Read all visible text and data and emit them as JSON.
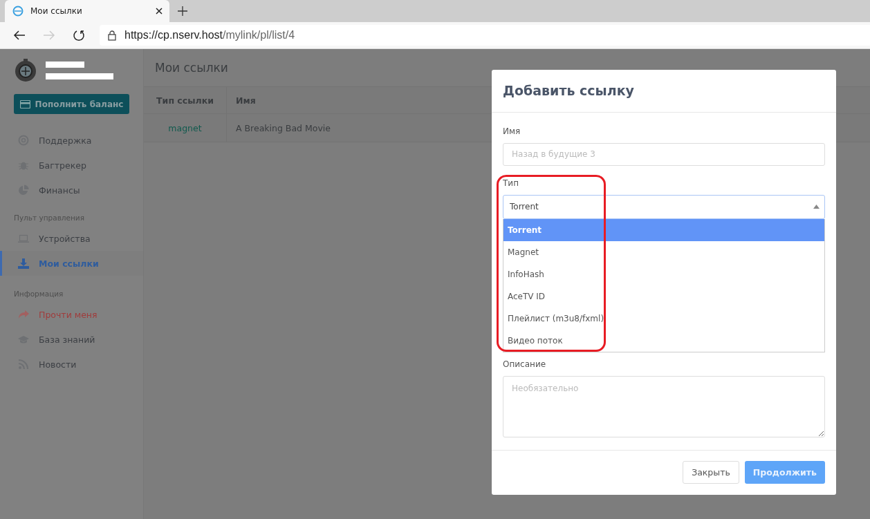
{
  "browser": {
    "tab_title": "Мои ссылки",
    "url_host": "https://cp.nserv.host",
    "url_path": "/mylink/pl/list/4"
  },
  "sidebar": {
    "balance_button": "Пополнить баланс",
    "groups": [
      {
        "items": [
          {
            "label": "Поддержка",
            "selected": false,
            "kind": "normal"
          },
          {
            "label": "Багтрекер",
            "selected": false,
            "kind": "normal"
          },
          {
            "label": "Финансы",
            "selected": false,
            "kind": "normal"
          }
        ]
      },
      {
        "heading": "Пульт управления",
        "items": [
          {
            "label": "Устройства",
            "selected": false,
            "kind": "normal"
          },
          {
            "label": "Мои ссылки",
            "selected": true,
            "kind": "normal"
          }
        ]
      },
      {
        "heading": "Информация",
        "items": [
          {
            "label": "Прочти меня",
            "selected": false,
            "kind": "alert"
          },
          {
            "label": "База знаний",
            "selected": false,
            "kind": "normal"
          },
          {
            "label": "Новости",
            "selected": false,
            "kind": "normal"
          }
        ]
      }
    ]
  },
  "page": {
    "title": "Мои ссылки",
    "table": {
      "columns": [
        "Тип ссылки",
        "Имя"
      ],
      "rows": [
        {
          "type": "magnet",
          "name": "A Breaking Bad Movie"
        }
      ]
    }
  },
  "modal": {
    "title": "Добавить ссылку",
    "name_label": "Имя",
    "name_placeholder": "Назад в будущие 3",
    "type_label": "Тип",
    "type_value": "Torrent",
    "options": [
      {
        "label": "Torrent",
        "selected": true
      },
      {
        "label": "Magnet",
        "selected": false
      },
      {
        "label": "InfoHash",
        "selected": false
      },
      {
        "label": "AceTV ID",
        "selected": false
      },
      {
        "label": "Плейлист (m3u8/fxml)",
        "selected": false
      },
      {
        "label": "Видео поток",
        "selected": false
      }
    ],
    "description_label": "Описание",
    "description_placeholder": "Необязательно",
    "buttons": [
      {
        "label": "Закрыть",
        "kind": "secondary"
      },
      {
        "label": "Продолжить",
        "kind": "primary"
      }
    ]
  }
}
